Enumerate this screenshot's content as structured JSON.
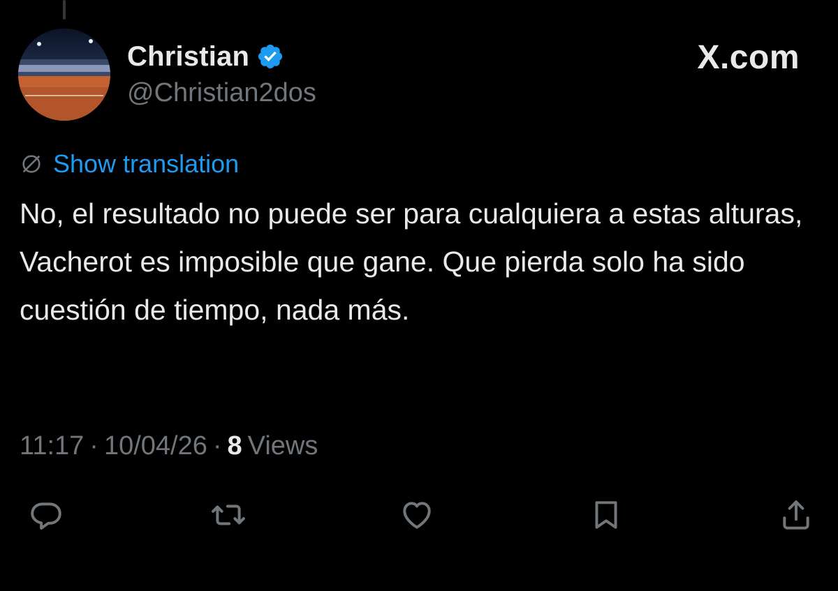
{
  "user": {
    "display_name": "Christian",
    "handle": "@Christian2dos",
    "verified": true,
    "verified_icon": "verified-badge-icon"
  },
  "brand": {
    "label": "X.com"
  },
  "translation": {
    "icon": "globe-slash-icon",
    "label": "Show translation"
  },
  "tweet": {
    "text": "No, el resultado no puede ser para cualquiera a estas alturas, Vacherot es imposible que gane. Que pierda solo ha sido cuestión de tiempo, nada más."
  },
  "meta": {
    "time": "11:17",
    "separator": "·",
    "date": "10/04/26",
    "views_count": "8",
    "views_label": "Views"
  },
  "actions": [
    {
      "name": "reply",
      "icon": "reply-icon"
    },
    {
      "name": "repost",
      "icon": "repost-icon"
    },
    {
      "name": "like",
      "icon": "heart-icon"
    },
    {
      "name": "bookmark",
      "icon": "bookmark-icon"
    },
    {
      "name": "share",
      "icon": "share-icon"
    }
  ],
  "colors": {
    "background": "#000000",
    "text_primary": "#e7e9ea",
    "text_secondary": "#71767b",
    "accent": "#1d9bf0"
  }
}
